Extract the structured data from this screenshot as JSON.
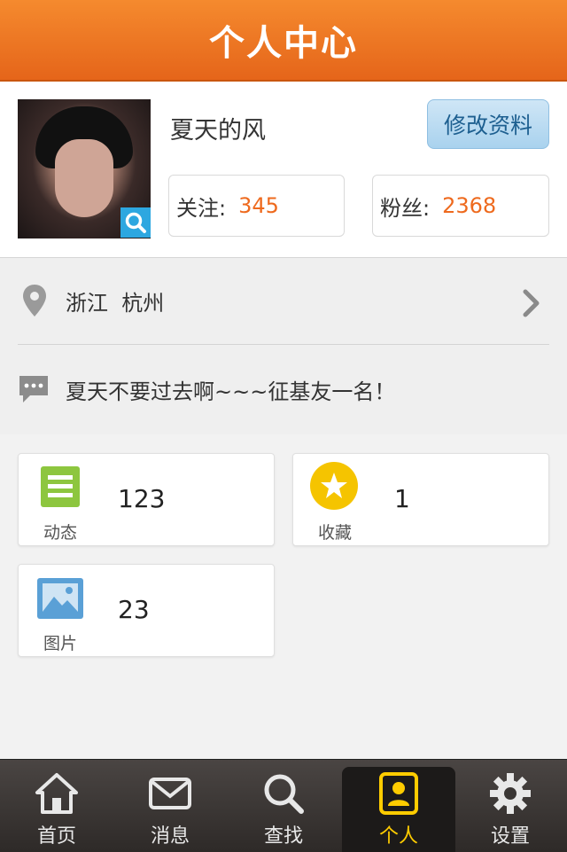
{
  "header": {
    "title": "个人中心"
  },
  "profile": {
    "name": "夏天的风",
    "edit_label": "修改资料",
    "follow": {
      "label": "关注:",
      "value": "345"
    },
    "fans": {
      "label": "粉丝:",
      "value": "2368"
    }
  },
  "location": {
    "province": "浙江",
    "city": "杭州"
  },
  "signature": "夏天不要过去啊~~~征基友一名！",
  "cards": [
    {
      "label": "动态",
      "count": "123",
      "icon": "list-icon",
      "color": "#8dc63f"
    },
    {
      "label": "收藏",
      "count": "1",
      "icon": "star-icon",
      "color": "#f5c400"
    },
    {
      "label": "图片",
      "count": "23",
      "icon": "image-icon",
      "color": "#5aa0d6"
    }
  ],
  "tabs": [
    {
      "label": "首页",
      "icon": "home-icon"
    },
    {
      "label": "消息",
      "icon": "mail-icon"
    },
    {
      "label": "查找",
      "icon": "search-icon"
    },
    {
      "label": "个人",
      "icon": "profile-icon",
      "active": true
    },
    {
      "label": "设置",
      "icon": "gear-icon"
    }
  ],
  "colors": {
    "header": "#ee731f",
    "accent": "#ee6a1e",
    "active_tab": "#ffcc00"
  }
}
